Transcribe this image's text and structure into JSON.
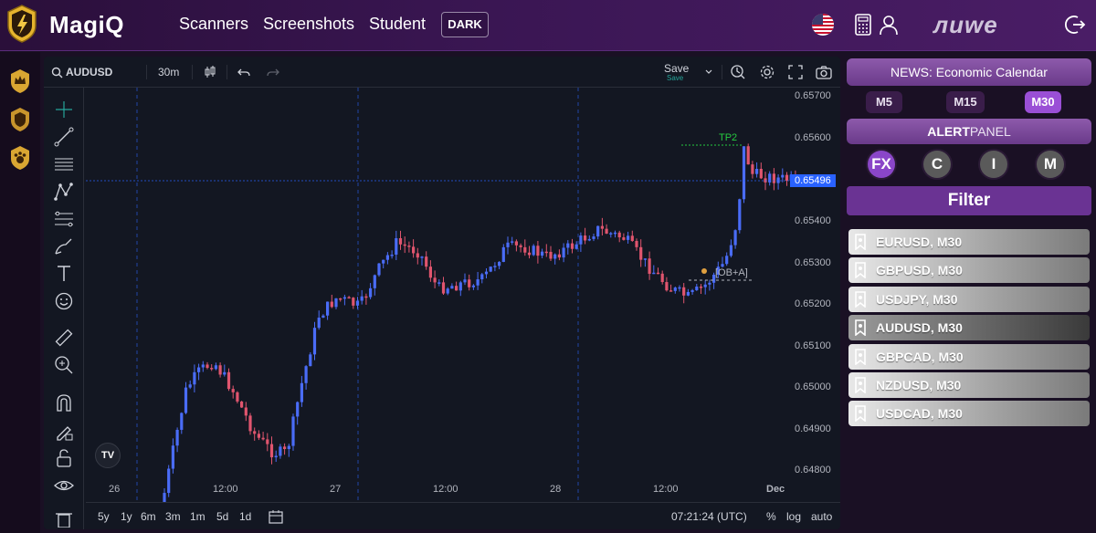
{
  "app": {
    "name": "MagiQ",
    "username": "лиwe"
  },
  "nav": {
    "links": [
      "Scanners",
      "Screenshots",
      "Student"
    ],
    "theme_button": "DARK"
  },
  "chart": {
    "symbol": "AUDUSD",
    "interval": "30m",
    "save_label": "Save",
    "save_sub": "Save",
    "price_axis": [
      "0.65700",
      "0.65600",
      "0.65400",
      "0.65300",
      "0.65200",
      "0.65100",
      "0.65000",
      "0.64900",
      "0.64800"
    ],
    "current_price": "0.65496",
    "time_axis": [
      "26",
      "12:00",
      "27",
      "12:00",
      "28",
      "12:00",
      "Dec"
    ],
    "annotations": {
      "tp": "TP2",
      "ob": "[OB+A]"
    },
    "ranges": [
      "5y",
      "1y",
      "6m",
      "3m",
      "1m",
      "5d",
      "1d"
    ],
    "clock": "07:21:24 (UTC)",
    "scale_opts": [
      "%",
      "log",
      "auto"
    ],
    "accent_up": "#4a6cf7",
    "accent_down": "#e0556e"
  },
  "news": {
    "header": "NEWS: Economic Calendar",
    "timeframes": [
      "M5",
      "M15",
      "M30"
    ],
    "active": "M30"
  },
  "alerts": {
    "header_bold": "ALERT",
    "header_thin": "PANEL",
    "categories": [
      "FX",
      "C",
      "I",
      "M"
    ],
    "filter_label": "Filter",
    "items": [
      "EURUSD, M30",
      "GBPUSD, M30",
      "USDJPY, M30",
      "AUDUSD, M30",
      "GBPCAD, M30",
      "NZDUSD, M30",
      "USDCAD, M30"
    ],
    "selected": "AUDUSD, M30"
  }
}
